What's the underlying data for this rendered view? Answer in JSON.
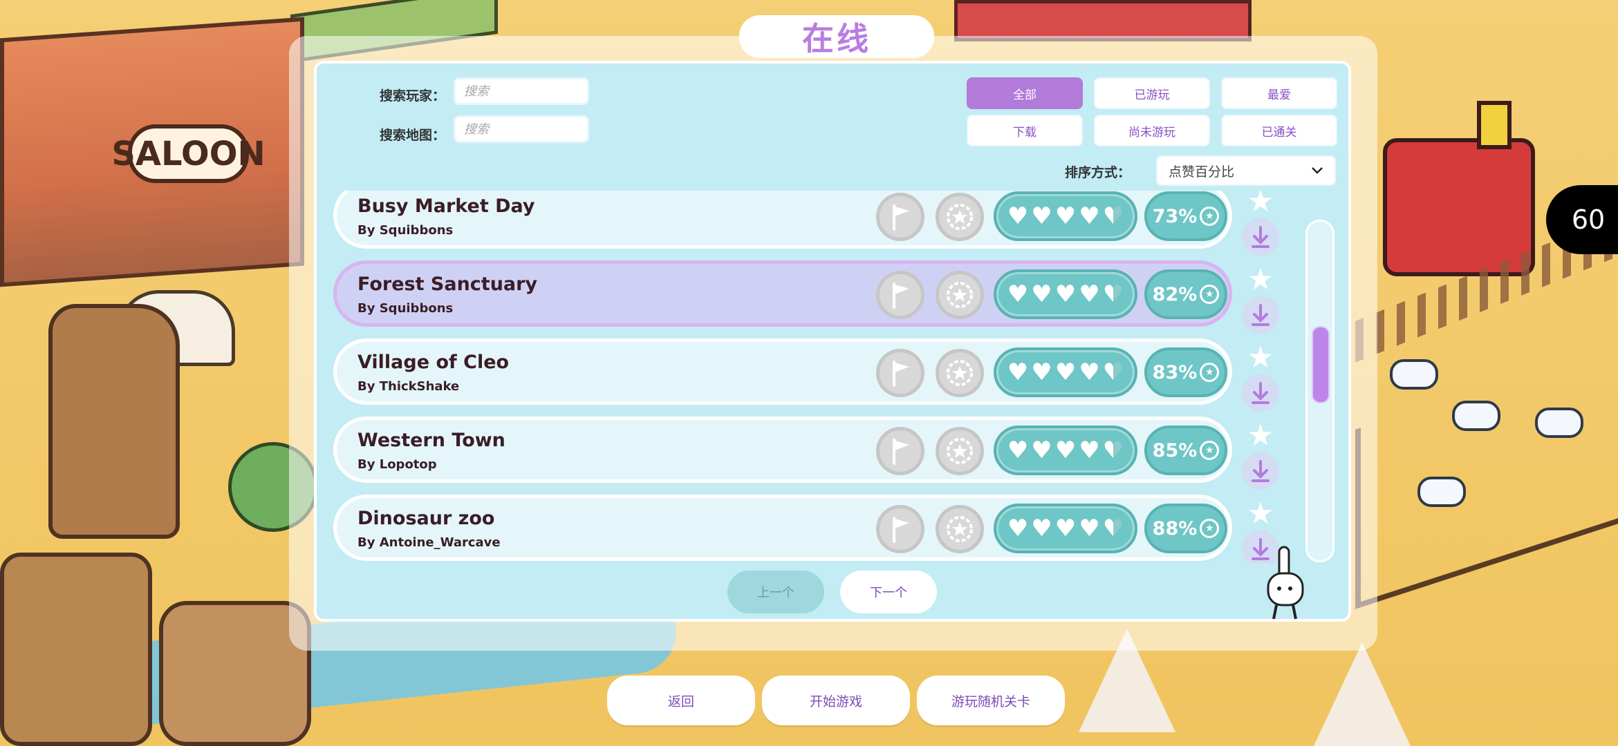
{
  "title": "在线",
  "search": {
    "player_label": "搜索玩家：",
    "map_label": "搜索地图：",
    "placeholder": "搜索"
  },
  "filters": [
    {
      "label": "全部",
      "active": true
    },
    {
      "label": "已游玩",
      "active": false
    },
    {
      "label": "最爱",
      "active": false
    },
    {
      "label": "下载",
      "active": false
    },
    {
      "label": "尚未游玩",
      "active": false
    },
    {
      "label": "已通关",
      "active": false
    }
  ],
  "sort": {
    "label": "排序方式：",
    "selected": "点赞百分比"
  },
  "maps": [
    {
      "name": "Busy Market Day",
      "author": "By Squibbons",
      "rating": 4.5,
      "percent": "73%",
      "selected": false
    },
    {
      "name": "Forest Sanctuary",
      "author": "By Squibbons",
      "rating": 4.5,
      "percent": "82%",
      "selected": true
    },
    {
      "name": "Village of Cleo",
      "author": "By ThickShake",
      "rating": 4.5,
      "percent": "83%",
      "selected": false
    },
    {
      "name": "Western Town",
      "author": "By Lopotop",
      "rating": 4.5,
      "percent": "85%",
      "selected": false
    },
    {
      "name": "Dinosaur zoo",
      "author": "By Antoine_Warcave",
      "rating": 4.5,
      "percent": "88%",
      "selected": false
    }
  ],
  "scrollbar": {
    "position": 0.4
  },
  "pagination": {
    "prev": "上一个",
    "next": "下一个"
  },
  "fps": "60",
  "bottom": {
    "back": "返回",
    "start": "开始游戏",
    "random": "游玩随机关卡"
  },
  "background": {
    "saloon_sign": "SALOON"
  },
  "colors": {
    "accent": "#b27ad9",
    "panel": "#c3ecf5",
    "pill": "#6fc6c6",
    "title": "#b87ee0"
  }
}
